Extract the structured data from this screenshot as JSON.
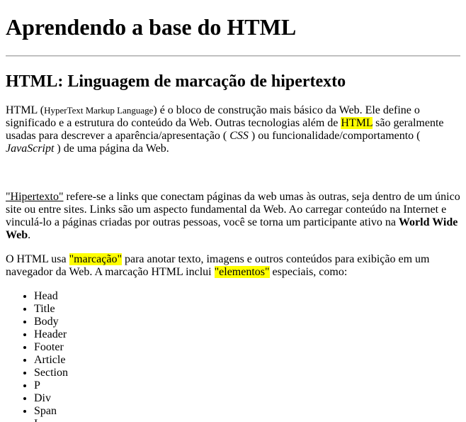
{
  "title": "Aprendendo a base do HTML",
  "subtitle": "HTML: Linguagem de marcação de hipertexto",
  "para1": {
    "t1": "HTML (",
    "acronym": "HyperText Markup Language",
    "t2": ") é o bloco de construção mais básico da Web. Ele define o significado e a estrutura do conteúdo da Web. Outras tecnologias além de ",
    "hl": "HTML",
    "t3": " são geralmente usadas para descrever a aparência/apresentação ( ",
    "css": "CSS",
    "t4": " ) ou funcionalidade/comportamento ( ",
    "js": "JavaScript",
    "t5": " ) de uma página da Web."
  },
  "para2": {
    "link": "\"Hipertexto\"",
    "t1": " refere-se a links que conectam páginas da web umas às outras, seja dentro de um único site ou entre sites. Links são um aspecto fundamental da Web. Ao carregar conteúdo na Internet e vinculá-lo a páginas criadas por outras pessoas, você se torna um participante ativo na ",
    "bold": "World Wide Web",
    "t2": "."
  },
  "para3": {
    "t1": "O HTML usa ",
    "hl1": "\"marcação\"",
    "t2": " para anotar texto, imagens e outros conteúdos para exibição em um navegador da Web. A marcação HTML inclui ",
    "hl2": "\"elementos\"",
    "t3": " especiais, como:"
  },
  "list": [
    "Head",
    "Title",
    "Body",
    "Header",
    "Footer",
    "Article",
    "Section",
    "P",
    "Div",
    "Span",
    "I"
  ],
  "colors": {
    "highlight": "#ffff00",
    "rule": "#a9a9a9"
  }
}
